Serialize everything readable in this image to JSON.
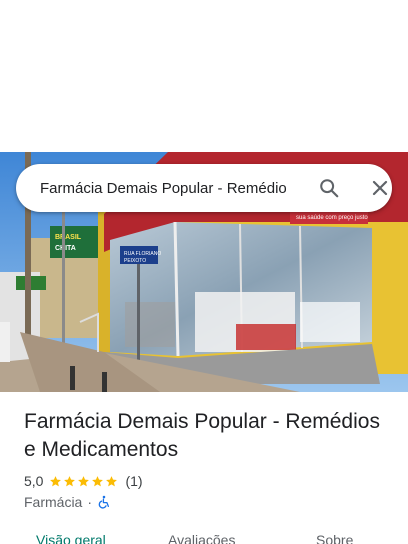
{
  "search": {
    "query": "Farmácia Demais Popular - Remédios e Medicamentos"
  },
  "photo": {
    "storefront_sign": "sua saúde com preço justo",
    "street_sign_line1": "RUA FLORIANO",
    "street_sign_line2": "PEIXOTO",
    "billboard_line1": "BRASIL",
    "billboard_line2": "CHITA"
  },
  "place": {
    "name": "Farmácia Demais Popular - Remédios e Medicamentos",
    "rating": "5,0",
    "star_count": 5,
    "review_count": "(1)",
    "category": "Farmácia",
    "separator": "·",
    "accessibility_icon": "wheelchair-icon"
  },
  "tabs": [
    {
      "label": "Visão geral",
      "active": true
    },
    {
      "label": "Avaliações",
      "active": false
    },
    {
      "label": "Sobre",
      "active": false
    }
  ],
  "colors": {
    "star": "#fbbc04",
    "active_tab": "#00796b",
    "accessibility": "#1a73e8"
  }
}
